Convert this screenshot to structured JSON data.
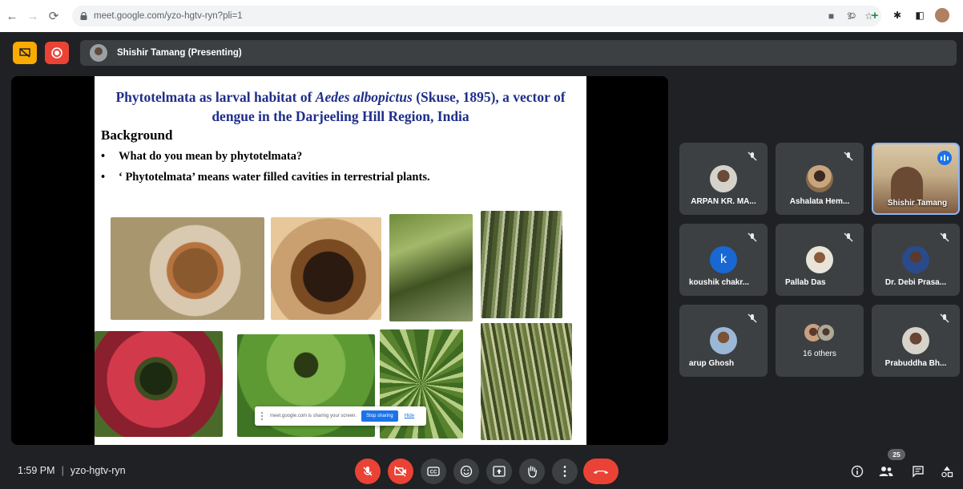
{
  "browser": {
    "url": "meet.google.com/yzo-hgtv-ryn?pli=1"
  },
  "meet": {
    "presenter_label": "Shishir Tamang (Presenting)",
    "meeting_time": "1:59 PM",
    "meeting_code": "yzo-hgtv-ryn",
    "participant_count": "25"
  },
  "slide": {
    "title_part1": "Phytotelmata as larval habitat of ",
    "title_species": "Aedes albopictus",
    "title_part2": " (Skuse, 1895), a vector of dengue in the Darjeeling Hill Region, India",
    "heading": "Background",
    "bullets": [
      "What do you mean by phytotelmata?",
      "‘ Phytotelmata’ means water filled cavities in terrestrial plants."
    ]
  },
  "share_bar": {
    "text": "meet.google.com is sharing your screen.",
    "stop_label": "Stop sharing",
    "hide_label": "Hide"
  },
  "participants": [
    {
      "name": "ARPAN KR. MA..."
    },
    {
      "name": "Ashalata Hem..."
    },
    {
      "name": "Shishir Tamang"
    },
    {
      "name": "koushik chakr...",
      "initial": "k"
    },
    {
      "name": "Pallab Das"
    },
    {
      "name": "Dr. Debi Prasa..."
    },
    {
      "name": "arup Ghosh"
    },
    {
      "name": "16 others"
    },
    {
      "name": "Prabuddha Bh..."
    }
  ],
  "colors": {
    "meet_bg": "#202124",
    "tile_bg": "#3c4043",
    "red": "#ea4335",
    "yellow": "#f9ab00",
    "blue": "#1a73e8",
    "slide_title": "#1f2f8a"
  }
}
